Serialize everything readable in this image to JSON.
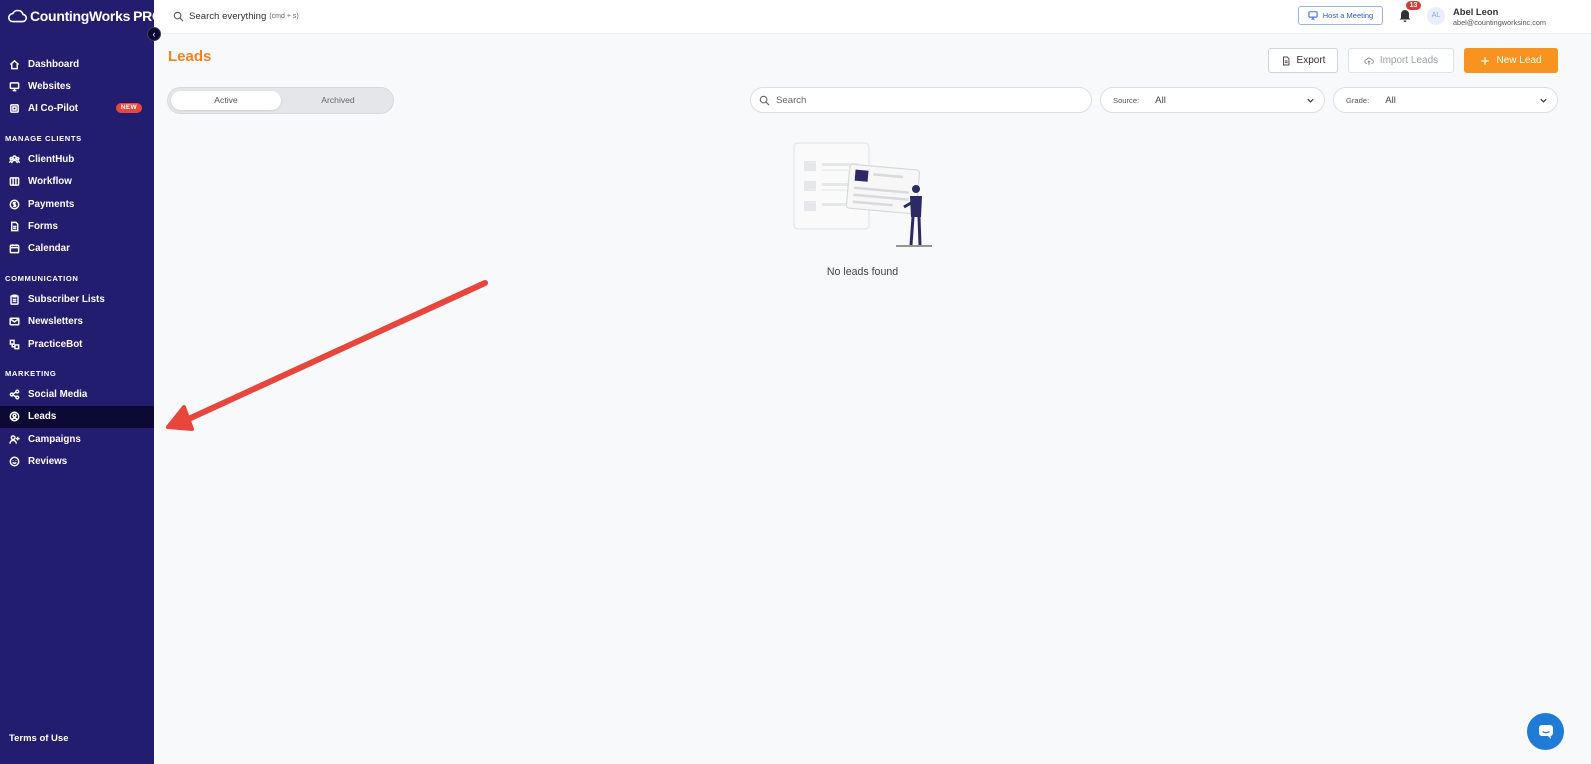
{
  "app": {
    "logo_name": "CountingWorks",
    "logo_pro": "PRO"
  },
  "sidebar": {
    "top_items": [
      {
        "label": "Dashboard",
        "icon": "home-icon"
      },
      {
        "label": "Websites",
        "icon": "monitor-icon"
      },
      {
        "label": "AI Co-Pilot",
        "icon": "chip-icon",
        "badge": "NEW"
      }
    ],
    "sections": [
      {
        "title": "MANAGE CLIENTS",
        "items": [
          {
            "label": "ClientHub",
            "icon": "users-icon"
          },
          {
            "label": "Workflow",
            "icon": "columns-icon"
          },
          {
            "label": "Payments",
            "icon": "dollar-icon"
          },
          {
            "label": "Forms",
            "icon": "document-icon"
          },
          {
            "label": "Calendar",
            "icon": "calendar-icon"
          }
        ]
      },
      {
        "title": "COMMUNICATION",
        "items": [
          {
            "label": "Subscriber Lists",
            "icon": "clipboard-icon"
          },
          {
            "label": "Newsletters",
            "icon": "mail-icon"
          },
          {
            "label": "PracticeBot",
            "icon": "bot-icon"
          }
        ]
      },
      {
        "title": "MARKETING",
        "items": [
          {
            "label": "Social Media",
            "icon": "share-icon"
          },
          {
            "label": "Leads",
            "icon": "user-circle-icon",
            "active": true
          },
          {
            "label": "Campaigns",
            "icon": "user-plus-icon"
          },
          {
            "label": "Reviews",
            "icon": "smile-icon"
          }
        ]
      }
    ],
    "terms": "Terms of Use",
    "colors": {
      "background": "#221d6e",
      "active": "#0c0a35"
    }
  },
  "header": {
    "search_label": "Search everything",
    "search_hint": "(cmd + s)",
    "host_meeting": "Host a Meeting",
    "notification_count": "13",
    "avatar_initials": "AL",
    "user_name": "Abel Leon",
    "user_email": "abel@countingworksinc.com"
  },
  "main": {
    "title": "Leads",
    "export_label": "Export",
    "import_label": "Import Leads",
    "new_label": "New Lead",
    "tabs": {
      "active": "Active",
      "archived": "Archived"
    },
    "search_placeholder": "Search",
    "source": {
      "label": "Source:",
      "value": "All"
    },
    "grade": {
      "label": "Grade:",
      "value": "All"
    },
    "empty_text": "No leads found",
    "colors": {
      "accent": "#f7931e",
      "title": "#f58220"
    }
  },
  "annotation": {
    "arrow_color": "#e8453c"
  }
}
